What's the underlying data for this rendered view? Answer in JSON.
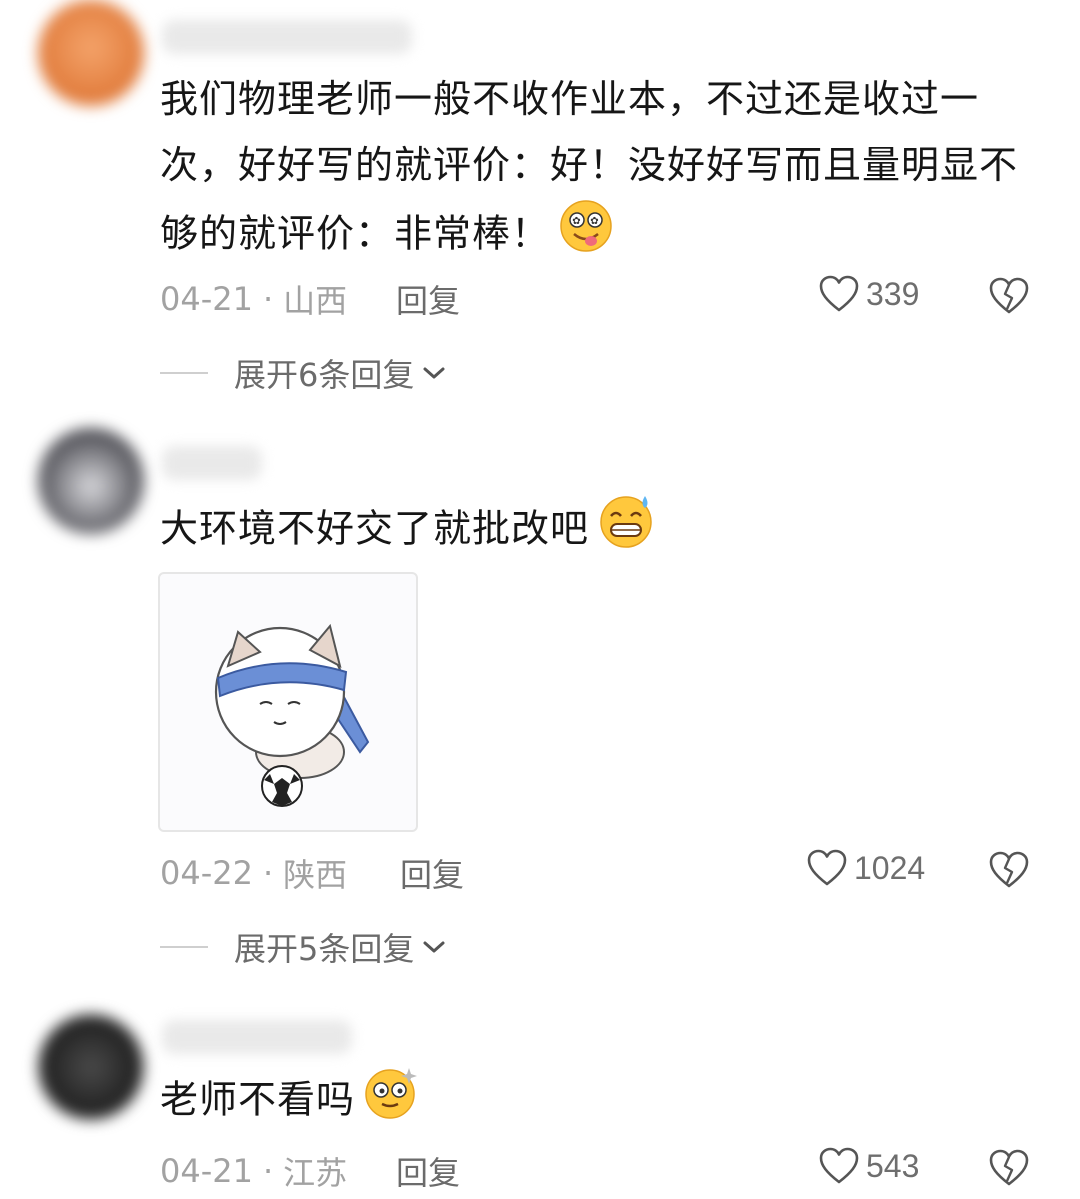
{
  "comments": [
    {
      "text": "我们物理老师一般不收作业本，不过还是收过一次，好好写的就评价：好！没好好写而且量明显不够的就评价：非常棒！",
      "date": "04-21",
      "sep": "·",
      "location": "山西",
      "reply_label": "回复",
      "likes": "339",
      "expand_label": "展开6条回复",
      "emoji": "drooling-face-icon"
    },
    {
      "text": "大环境不好交了就批改吧",
      "date": "04-22",
      "sep": "·",
      "location": "陕西",
      "reply_label": "回复",
      "likes": "1024",
      "expand_label": "展开5条回复",
      "emoji": "grinning-sweat-face-icon",
      "sticker": "cat-meme-sticker-football"
    },
    {
      "text": "老师不看吗",
      "date": "04-21",
      "sep": "·",
      "location": "江苏",
      "reply_label": "回复",
      "likes": "543",
      "emoji": "dizzy-eyes-face-icon"
    }
  ],
  "colors": {
    "meta_gray": "#a2a2a2",
    "action_gray": "#6b6b6b",
    "emoji_yellow": "#ffc83d"
  }
}
